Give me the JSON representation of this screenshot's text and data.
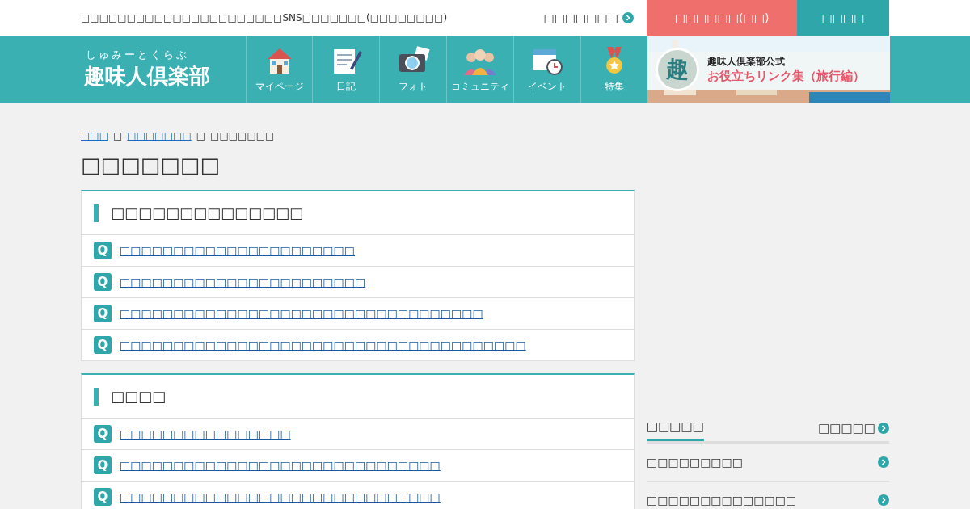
{
  "topbar": {
    "tagline": "□□□□□□□□□□□□□□□□□□□□□□SNS□□□□□□□(□□□□□□□□)",
    "account_link": "□□□□□□□",
    "register_button": "□□□□□□(□□)",
    "login_button": "□□□□"
  },
  "logo": {
    "ruby": "しゅみーとくらぶ",
    "name": "趣味人倶楽部"
  },
  "nav": [
    {
      "label": "マイページ",
      "kind": "house"
    },
    {
      "label": "日記",
      "kind": "diary"
    },
    {
      "label": "フォト",
      "kind": "camera"
    },
    {
      "label": "コミュニティ",
      "kind": "people"
    },
    {
      "label": "イベント",
      "kind": "calendar"
    },
    {
      "label": "特集",
      "kind": "medal"
    }
  ],
  "banner": {
    "badge": "趣",
    "title": "趣味人倶楽部公式",
    "subtitle": "お役立ちリンク集（旅行編）"
  },
  "breadcrumb": [
    {
      "text": "□□□",
      "link": true
    },
    {
      "text": "□",
      "link": false
    },
    {
      "text": "□□□□□□□",
      "link": true
    },
    {
      "text": "□",
      "link": false
    },
    {
      "text": "□□□□□□□",
      "link": false
    }
  ],
  "page_title": "□□□□□□□",
  "sections": [
    {
      "heading": "□□□□□□□□□□□□□□",
      "questions": [
        {
          "mark": "Q",
          "text": "□□□□□□□□□□□□□□□□□□□□□□"
        },
        {
          "mark": "Q",
          "text": "□□□□□□□□□□□□□□□□□□□□□□□"
        },
        {
          "mark": "Q",
          "text": "□□□□□□□□□□□□□□□□□□□□□□□□□□□□□□□□□□"
        },
        {
          "mark": "Q",
          "text": "□□□□□□□□□□□□□□□□□□□□□□□□□□□□□□□□□□□□□□"
        }
      ]
    },
    {
      "heading": "□□□□",
      "questions": [
        {
          "mark": "Q",
          "text": "□□□□□□□□□□□□□□□□"
        },
        {
          "mark": "Q",
          "text": "□□□□□□□□□□□□□□□□□□□□□□□□□□□□□□"
        },
        {
          "mark": "Q",
          "text": "□□□□□□□□□□□□□□□□□□□□□□□□□□□□□□"
        }
      ]
    }
  ],
  "sidebar": {
    "tabs": [
      {
        "label": "□□□□□",
        "selected": true
      },
      {
        "label": "□□□□□",
        "selected": false
      }
    ],
    "items": [
      "□□□□□□□□□",
      "□□□□□□□□□□□□□□"
    ]
  }
}
